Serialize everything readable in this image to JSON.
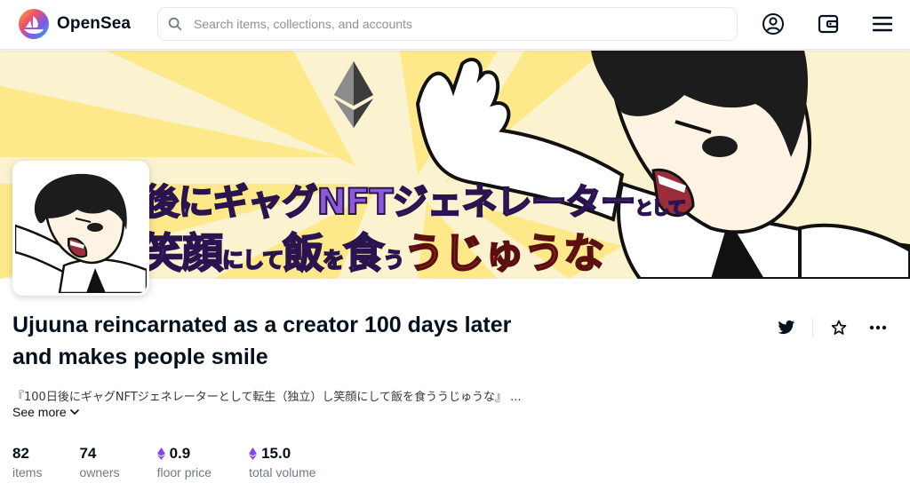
{
  "nav": {
    "brand": "OpenSea",
    "search_placeholder": "Search items, collections, and accounts",
    "icons": [
      "profile-icon",
      "wallet-icon",
      "menu-icon"
    ]
  },
  "banner": {
    "line1_main": "100日後にギャグNFTジェネレーター",
    "line1_small": "として",
    "line2_a": "笑顔",
    "line2_b": "にして",
    "line2_c": "飯",
    "line2_d": "を",
    "line2_e": "食",
    "line2_f": "う",
    "line2_red": "うじゅうな"
  },
  "collection": {
    "title": "Ujuuna reincarnated as a creator 100 days later and makes people smile",
    "description": "『100日後にギャグNFTジェネレーターとして転生（独立）し笑顔にして飯を食ううじゅうな』 ...",
    "see_more": "See more",
    "actions": [
      "twitter-icon",
      "star-icon",
      "more-icon"
    ]
  },
  "stats": [
    {
      "value": "82",
      "label": "items",
      "eth": false
    },
    {
      "value": "74",
      "label": "owners",
      "eth": false
    },
    {
      "value": "0.9",
      "label": "floor price",
      "eth": true
    },
    {
      "value": "15.0",
      "label": "total volume",
      "eth": true
    }
  ],
  "colors": {
    "text": "#04111d",
    "muted": "#707a83",
    "border": "#e5e8eb",
    "eth_purple": "#8247e5",
    "banner_bg": "#fbf3cf"
  }
}
